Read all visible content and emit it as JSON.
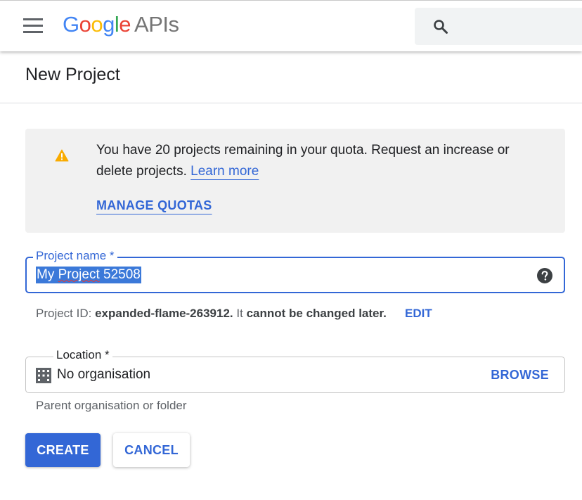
{
  "header": {
    "logo": {
      "G": "G",
      "o1": "o",
      "o2": "o",
      "g": "g",
      "l": "l",
      "e": "e",
      "product": "APIs"
    },
    "search": {
      "icon": "search-icon"
    },
    "menu_icon": "hamburger-menu-icon"
  },
  "page": {
    "title": "New Project"
  },
  "quota": {
    "message": "You have 20 projects remaining in your quota. Request an increase or delete projects.",
    "learn_more": "Learn more",
    "manage_quotas": "MANAGE QUOTAS",
    "icon": "warning-icon"
  },
  "project_name": {
    "label": "Project name *",
    "value_prefix": "My ",
    "value_word": "Project",
    "value_suffix": " 52508",
    "help_icon": "help-icon"
  },
  "project_id": {
    "prefix": "Project ID:",
    "id": "expanded-flame-263912.",
    "it": "It",
    "note": "cannot be changed later.",
    "edit": "EDIT"
  },
  "location": {
    "label": "Location *",
    "value": "No organisation",
    "browse": "BROWSE",
    "hint": "Parent organisation or folder",
    "icon": "building-icon"
  },
  "actions": {
    "create": "CREATE",
    "cancel": "CANCEL"
  },
  "colors": {
    "accent": "#3367d6",
    "warning": "#f9ab00",
    "selection": "#3b79d9"
  }
}
